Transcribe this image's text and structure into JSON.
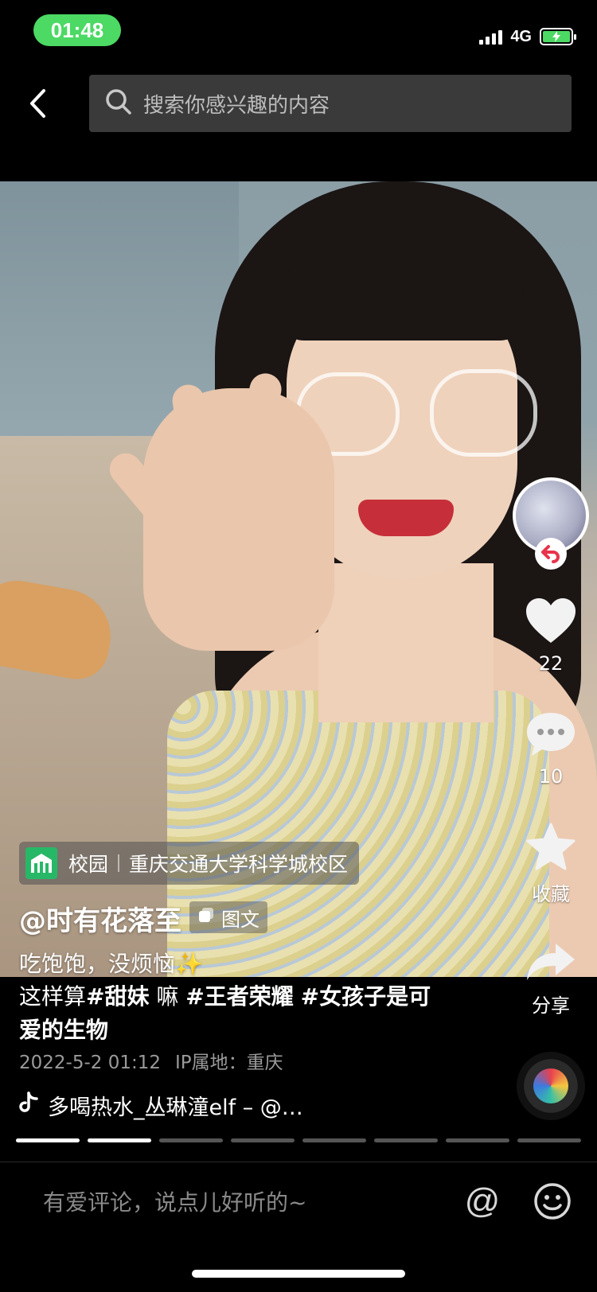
{
  "status_bar": {
    "time": "01:48",
    "network": "4G"
  },
  "header": {
    "search_placeholder": "搜索你感兴趣的内容"
  },
  "post": {
    "location_category": "校园",
    "location_name": "重庆交通大学科学城校区",
    "author": "@时有花落至",
    "type_tag": "图文",
    "caption_line1": "吃饱饱，没烦恼✨",
    "caption_line2_prefix": "这样算",
    "hashtag1": "#甜妹",
    "caption_line2_mid": " 嘛 ",
    "hashtag2": "#王者荣耀",
    "hashtag3": "#女孩子是可爱的生物",
    "date": "2022-5-2 01:12",
    "ip_location": "IP属地：重庆",
    "music": "多喝热水_丛琳潼elf – @…"
  },
  "actions": {
    "likes": "22",
    "comments": "10",
    "favorite_label": "收藏",
    "share_label": "分享"
  },
  "progress": {
    "total_segments": 8,
    "completed_segments": 2
  },
  "comment_bar": {
    "placeholder": "有爱评论，说点儿好听的~",
    "at_symbol": "@"
  },
  "colors": {
    "accent_green": "#27b867",
    "status_green": "#4cd964",
    "background": "#000000"
  },
  "icons": [
    "back-arrow-icon",
    "search-icon",
    "heart-icon",
    "comment-icon",
    "star-icon",
    "share-icon",
    "music-note-icon",
    "emoji-icon",
    "campus-icon",
    "image-text-icon"
  ]
}
